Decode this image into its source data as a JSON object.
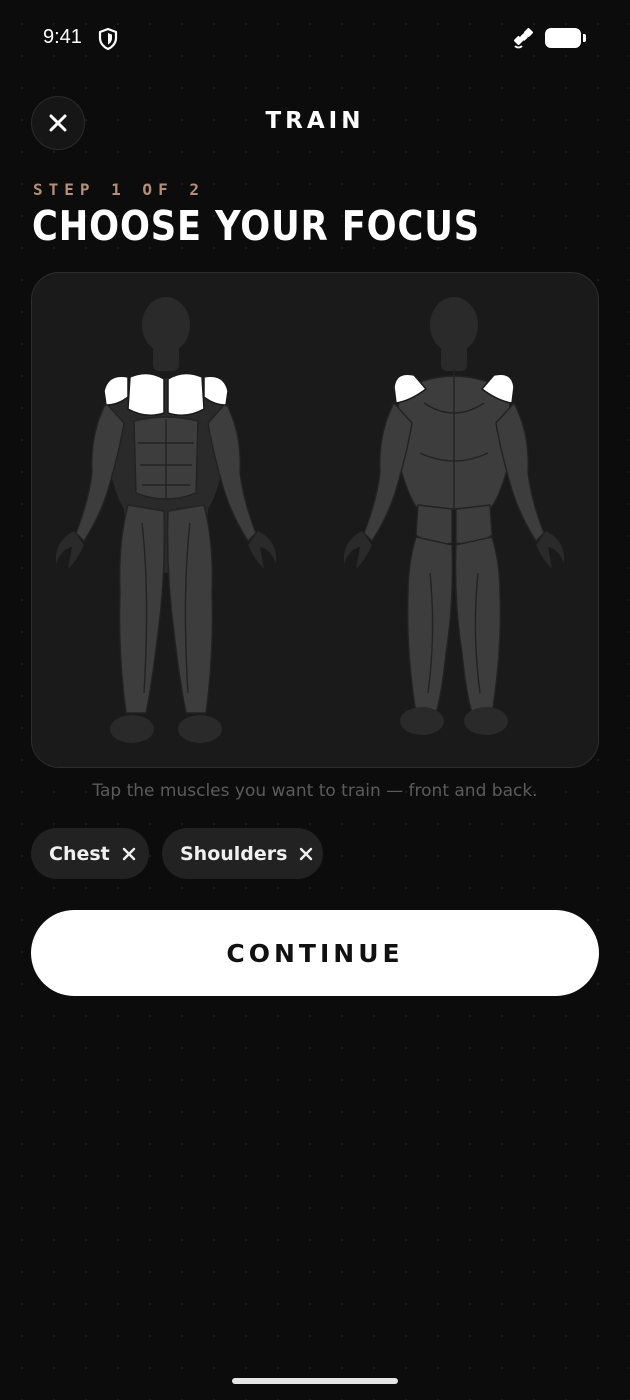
{
  "status_bar": {
    "time": "9:41",
    "icons": [
      "shield-icon",
      "satellite-icon",
      "battery-icon"
    ]
  },
  "nav": {
    "title": "TRAIN",
    "close_icon": "close-icon"
  },
  "step": {
    "label": "STEP 1 OF 2",
    "heading": "CHOOSE YOUR FOCUS"
  },
  "body_map": {
    "views": [
      "front",
      "back"
    ],
    "selected_muscles": [
      "Chest",
      "Shoulders"
    ]
  },
  "hint": "Tap the muscles you want to train — front and back.",
  "chips": [
    {
      "label": "Chest",
      "remove_icon": "close-icon"
    },
    {
      "label": "Shoulders",
      "remove_icon": "close-icon"
    }
  ],
  "continue_label": "CONTINUE",
  "colors": {
    "background": "#0c0c0c",
    "card": "#1a1a1a",
    "accent_step": "#b68f78",
    "muscle": "#3d3d3d",
    "selected": "#ffffff",
    "chip": "#222222"
  }
}
